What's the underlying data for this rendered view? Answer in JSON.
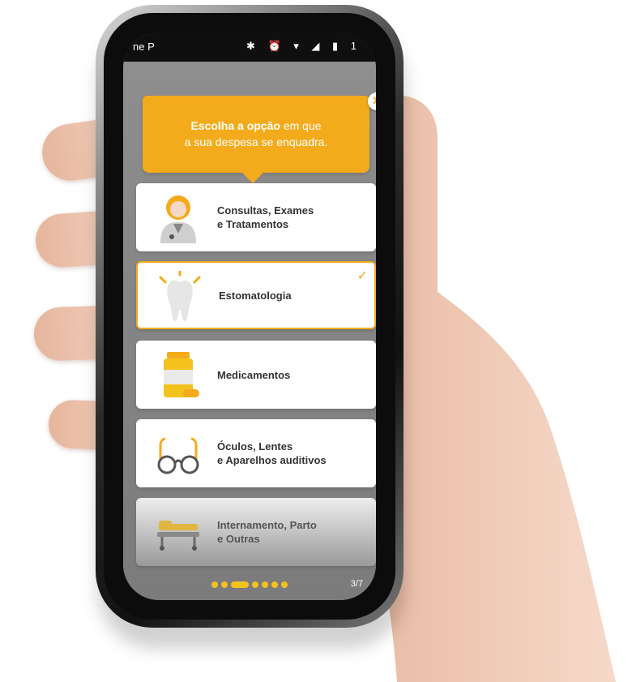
{
  "status_bar": {
    "carrier": "ne P",
    "icons": "✱ ⏰ ▾ ◢ ▮ 1"
  },
  "tooltip": {
    "bold_text": "Escolha a opção",
    "text_line1": " em que",
    "text_line2": "a sua despesa se enquadra."
  },
  "close_icon": "×",
  "options": [
    {
      "line1": "Consultas, Exames",
      "line2": "e Tratamentos",
      "icon": "doctor-icon",
      "selected": false
    },
    {
      "line1": "Estomatologia",
      "line2": "",
      "icon": "tooth-icon",
      "selected": true
    },
    {
      "line1": "Medicamentos",
      "line2": "",
      "icon": "medicine-icon",
      "selected": false
    },
    {
      "line1": "Óculos, Lentes",
      "line2": "e Aparelhos auditivos",
      "icon": "glasses-icon",
      "selected": false
    },
    {
      "line1": "Internamento, Parto",
      "line2": "e Outras",
      "icon": "hospital-bed-icon",
      "selected": false
    }
  ],
  "check_mark": "✓",
  "pager": {
    "current": 3,
    "total": 7,
    "label": "3/7"
  },
  "colors": {
    "accent": "#f3ab1c",
    "overlay": "#7f7f7f"
  }
}
